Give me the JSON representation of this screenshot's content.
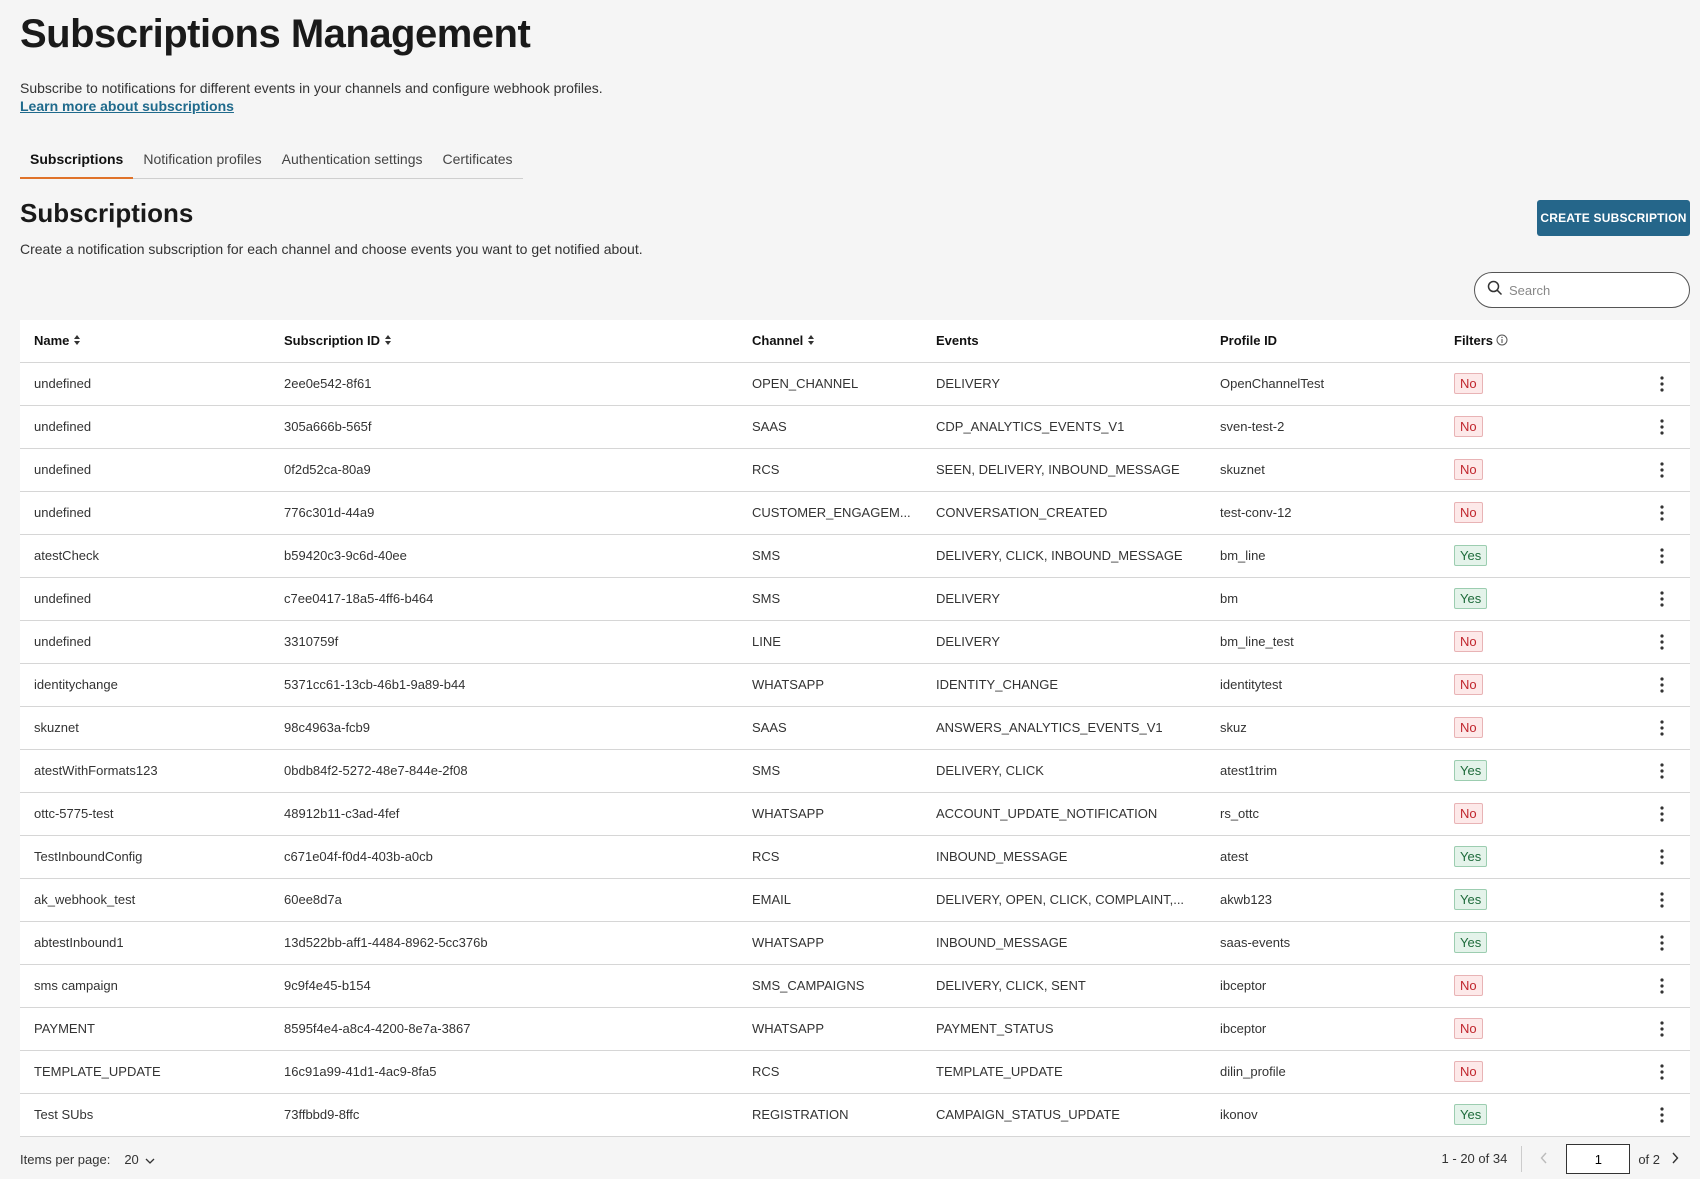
{
  "page": {
    "title": "Subscriptions Management",
    "description": "Subscribe to notifications for different events in your channels and configure webhook profiles.",
    "learn_more": "Learn more about subscriptions"
  },
  "tabs": [
    "Subscriptions",
    "Notification profiles",
    "Authentication settings",
    "Certificates"
  ],
  "section": {
    "title": "Subscriptions",
    "description": "Create a notification subscription for each channel and choose events you want to get notified about.",
    "create_button": "CREATE SUBSCRIPTION",
    "search_placeholder": "Search"
  },
  "table": {
    "columns": [
      "Name",
      "Subscription ID",
      "Channel",
      "Events",
      "Profile ID",
      "Filters"
    ],
    "rows": [
      {
        "name": "undefined",
        "id": "2ee0e542-8f61",
        "channel": "OPEN_CHANNEL",
        "events": "DELIVERY",
        "profile": "OpenChannelTest",
        "filters": "No"
      },
      {
        "name": "undefined",
        "id": "305a666b-565f",
        "channel": "SAAS",
        "events": "CDP_ANALYTICS_EVENTS_V1",
        "profile": "sven-test-2",
        "filters": "No"
      },
      {
        "name": "undefined",
        "id": "0f2d52ca-80a9",
        "channel": "RCS",
        "events": "SEEN, DELIVERY, INBOUND_MESSAGE",
        "profile": "skuznet",
        "filters": "No"
      },
      {
        "name": "undefined",
        "id": "776c301d-44a9",
        "channel": "CUSTOMER_ENGAGEM...",
        "events": "CONVERSATION_CREATED",
        "profile": "test-conv-12",
        "filters": "No"
      },
      {
        "name": "atestCheck",
        "id": "b59420c3-9c6d-40ee",
        "channel": "SMS",
        "events": "DELIVERY, CLICK, INBOUND_MESSAGE",
        "profile": "bm_line",
        "filters": "Yes"
      },
      {
        "name": "undefined",
        "id": "c7ee0417-18a5-4ff6-b464",
        "channel": "SMS",
        "events": "DELIVERY",
        "profile": "bm",
        "filters": "Yes"
      },
      {
        "name": "undefined",
        "id": "3310759f",
        "channel": "LINE",
        "events": "DELIVERY",
        "profile": "bm_line_test",
        "filters": "No"
      },
      {
        "name": "identitychange",
        "id": "5371cc61-13cb-46b1-9a89-b44",
        "channel": "WHATSAPP",
        "events": "IDENTITY_CHANGE",
        "profile": "identitytest",
        "filters": "No"
      },
      {
        "name": "skuznet",
        "id": "98c4963a-fcb9",
        "channel": "SAAS",
        "events": "ANSWERS_ANALYTICS_EVENTS_V1",
        "profile": "skuz",
        "filters": "No"
      },
      {
        "name": "atestWithFormats123",
        "id": "0bdb84f2-5272-48e7-844e-2f08",
        "channel": "SMS",
        "events": "DELIVERY, CLICK",
        "profile": "atest1trim",
        "filters": "Yes"
      },
      {
        "name": "ottc-5775-test",
        "id": "48912b11-c3ad-4fef",
        "channel": "WHATSAPP",
        "events": "ACCOUNT_UPDATE_NOTIFICATION",
        "profile": "rs_ottc",
        "filters": "No"
      },
      {
        "name": "TestInboundConfig",
        "id": "c671e04f-f0d4-403b-a0cb",
        "channel": "RCS",
        "events": "INBOUND_MESSAGE",
        "profile": "atest",
        "filters": "Yes"
      },
      {
        "name": "ak_webhook_test",
        "id": "60ee8d7a",
        "channel": "EMAIL",
        "events": "DELIVERY, OPEN, CLICK, COMPLAINT,...",
        "profile": "akwb123",
        "filters": "Yes"
      },
      {
        "name": "abtestInbound1",
        "id": "13d522bb-aff1-4484-8962-5cc376b",
        "channel": "WHATSAPP",
        "events": "INBOUND_MESSAGE",
        "profile": "saas-events",
        "filters": "Yes"
      },
      {
        "name": "sms campaign",
        "id": "9c9f4e45-b154",
        "channel": "SMS_CAMPAIGNS",
        "events": "DELIVERY, CLICK, SENT",
        "profile": "ibceptor",
        "filters": "No"
      },
      {
        "name": "PAYMENT",
        "id": "8595f4e4-a8c4-4200-8e7a-3867",
        "channel": "WHATSAPP",
        "events": "PAYMENT_STATUS",
        "profile": "ibceptor",
        "filters": "No"
      },
      {
        "name": "TEMPLATE_UPDATE",
        "id": "16c91a99-41d1-4ac9-8fa5",
        "channel": "RCS",
        "events": "TEMPLATE_UPDATE",
        "profile": "dilin_profile",
        "filters": "No"
      },
      {
        "name": "Test SUbs",
        "id": "73ffbbd9-8ffc",
        "channel": "REGISTRATION",
        "events": "CAMPAIGN_STATUS_UPDATE",
        "profile": "ikonov",
        "filters": "Yes"
      }
    ]
  },
  "pagination": {
    "items_per_page_label": "Items per page:",
    "items_per_page": "20",
    "range": "1 - 20 of 34",
    "current_page": "1",
    "of_pages": "of 2"
  },
  "colors": {
    "accent": "#25668a",
    "tab_underline": "#e0732a",
    "no_badge": "#c0262d",
    "yes_badge": "#1e6b3b"
  },
  "icons": [
    "search-icon",
    "sort-icon",
    "info-icon",
    "kebab-menu-icon",
    "chevron-down-icon",
    "chevron-left-icon",
    "chevron-right-icon"
  ]
}
